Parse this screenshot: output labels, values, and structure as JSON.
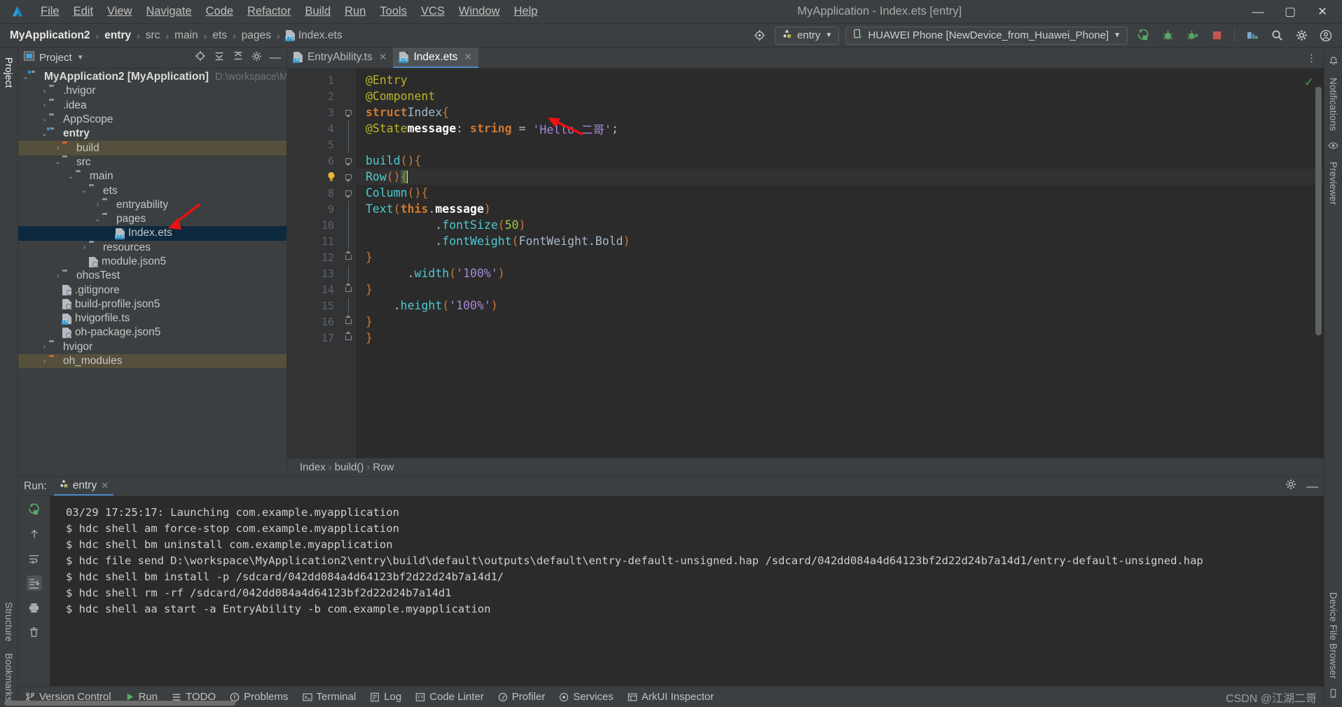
{
  "window": {
    "title": "MyApplication - Index.ets [entry]",
    "controls": {
      "minimize": "—",
      "maximize": "▢",
      "close": "✕"
    }
  },
  "menu": {
    "items": [
      "File",
      "Edit",
      "View",
      "Navigate",
      "Code",
      "Refactor",
      "Build",
      "Run",
      "Tools",
      "VCS",
      "Window",
      "Help"
    ]
  },
  "breadcrumbs": {
    "items": [
      "MyApplication2",
      "entry",
      "src",
      "main",
      "ets",
      "pages"
    ],
    "file": "Index.ets",
    "separator": "›"
  },
  "toolbar": {
    "target_icon": "device-target-icon",
    "run_config": "entry",
    "device": "HUAWEI Phone [NewDevice_from_Huawei_Phone]",
    "dropdown_caret": "▼",
    "buttons": [
      {
        "name": "run-button",
        "glyph": "▷"
      },
      {
        "name": "debug-button",
        "glyph": "🐞"
      },
      {
        "name": "attach-debugger-button",
        "glyph": "🐞"
      },
      {
        "name": "stop-button",
        "glyph": "■"
      },
      {
        "name": "device-manager-button",
        "glyph": "▤"
      },
      {
        "name": "search-everywhere-button",
        "glyph": "🔍"
      },
      {
        "name": "settings-button",
        "glyph": "⚙"
      },
      {
        "name": "account-button",
        "glyph": "◎"
      }
    ]
  },
  "left_rail": {
    "tabs": [
      "Project",
      "Structure",
      "Bookmarks"
    ]
  },
  "right_rail": {
    "tabs": [
      "Notifications",
      "Previewer",
      "Device File Browser"
    ]
  },
  "project_panel": {
    "title": "Project",
    "caret": "▼",
    "header_icons": [
      "locate-icon",
      "expand-all-icon",
      "collapse-all-icon",
      "settings-icon",
      "hide-icon"
    ],
    "tree": [
      {
        "depth": 0,
        "arrow": "v",
        "icon": "folder-module",
        "label": "MyApplication2 [MyApplication]",
        "bold": true,
        "path": "D:\\workspace\\MyApplic",
        "state": "normal"
      },
      {
        "depth": 1,
        "arrow": ">",
        "icon": "folder",
        "label": ".hvigor",
        "bold": false,
        "path": "",
        "state": "normal"
      },
      {
        "depth": 1,
        "arrow": ">",
        "icon": "folder",
        "label": ".idea",
        "bold": false,
        "path": "",
        "state": "normal"
      },
      {
        "depth": 1,
        "arrow": ">",
        "icon": "folder",
        "label": "AppScope",
        "bold": false,
        "path": "",
        "state": "normal"
      },
      {
        "depth": 1,
        "arrow": "v",
        "icon": "folder-module",
        "label": "entry",
        "bold": true,
        "path": "",
        "state": "normal"
      },
      {
        "depth": 2,
        "arrow": ">",
        "icon": "folder-orange",
        "label": "build",
        "bold": false,
        "path": "",
        "state": "modified"
      },
      {
        "depth": 2,
        "arrow": "v",
        "icon": "folder",
        "label": "src",
        "bold": false,
        "path": "",
        "state": "normal"
      },
      {
        "depth": 3,
        "arrow": "v",
        "icon": "folder",
        "label": "main",
        "bold": false,
        "path": "",
        "state": "normal"
      },
      {
        "depth": 4,
        "arrow": "v",
        "icon": "folder",
        "label": "ets",
        "bold": false,
        "path": "",
        "state": "normal"
      },
      {
        "depth": 5,
        "arrow": ">",
        "icon": "folder",
        "label": "entryability",
        "bold": false,
        "path": "",
        "state": "normal"
      },
      {
        "depth": 5,
        "arrow": "v",
        "icon": "folder",
        "label": "pages",
        "bold": false,
        "path": "",
        "state": "normal"
      },
      {
        "depth": 6,
        "arrow": "",
        "icon": "file-ets",
        "label": "Index.ets",
        "bold": false,
        "path": "",
        "state": "selected"
      },
      {
        "depth": 4,
        "arrow": ">",
        "icon": "folder",
        "label": "resources",
        "bold": false,
        "path": "",
        "state": "normal"
      },
      {
        "depth": 4,
        "arrow": "",
        "icon": "file-json",
        "label": "module.json5",
        "bold": false,
        "path": "",
        "state": "normal"
      },
      {
        "depth": 2,
        "arrow": ">",
        "icon": "folder",
        "label": "ohosTest",
        "bold": false,
        "path": "",
        "state": "normal"
      },
      {
        "depth": 2,
        "arrow": "",
        "icon": "file-git",
        "label": ".gitignore",
        "bold": false,
        "path": "",
        "state": "normal"
      },
      {
        "depth": 2,
        "arrow": "",
        "icon": "file-json",
        "label": "build-profile.json5",
        "bold": false,
        "path": "",
        "state": "normal"
      },
      {
        "depth": 2,
        "arrow": "",
        "icon": "file-ts",
        "label": "hvigorfile.ts",
        "bold": false,
        "path": "",
        "state": "normal"
      },
      {
        "depth": 2,
        "arrow": "",
        "icon": "file-json",
        "label": "oh-package.json5",
        "bold": false,
        "path": "",
        "state": "normal"
      },
      {
        "depth": 1,
        "arrow": ">",
        "icon": "folder",
        "label": "hvigor",
        "bold": false,
        "path": "",
        "state": "normal"
      },
      {
        "depth": 1,
        "arrow": ">",
        "icon": "folder-orange",
        "label": "oh_modules",
        "bold": false,
        "path": "",
        "state": "modified"
      }
    ]
  },
  "editor": {
    "tabs": [
      {
        "label": "EntryAbility.ts",
        "icon": "file-ts",
        "active": false,
        "close": "✕"
      },
      {
        "label": "Index.ets",
        "icon": "file-ets",
        "active": true,
        "close": "✕"
      }
    ],
    "kebab": "⋮",
    "inspection_ok": "✓",
    "line_numbers": [
      "1",
      "2",
      "3",
      "4",
      "5",
      "6",
      "7",
      "8",
      "9",
      "10",
      "11",
      "12",
      "13",
      "14",
      "15",
      "16",
      "17"
    ],
    "code": [
      "@Entry",
      "@Component",
      "struct Index {",
      "  @State message: string = 'Hello 二哥';",
      "",
      "  build() {",
      "    Row() {",
      "      Column() {",
      "        Text(this.message)",
      "          .fontSize(50)",
      "          .fontWeight(FontWeight.Bold)",
      "      }",
      "      .width('100%')",
      "    }",
      "    .height('100%')",
      "  }",
      "}"
    ],
    "breadcrumb": [
      "Index",
      "build()",
      "Row"
    ],
    "breadcrumb_sep": "›"
  },
  "run_panel": {
    "label": "Run:",
    "tab": "entry",
    "tab_close": "✕",
    "settings_icon": "⚙",
    "minimize_icon": "—",
    "rail_buttons": [
      "rerun-icon",
      "scroll-up-icon",
      "soft-wrap-icon",
      "scroll-to-end-icon",
      "print-icon",
      "clear-all-icon"
    ],
    "console": [
      "03/29 17:25:17: Launching com.example.myapplication",
      "$ hdc shell am force-stop com.example.myapplication",
      "$ hdc shell bm uninstall com.example.myapplication",
      "$ hdc file send D:\\workspace\\MyApplication2\\entry\\build\\default\\outputs\\default\\entry-default-unsigned.hap /sdcard/042dd084a4d64123bf2d22d24b7a14d1/entry-default-unsigned.hap",
      "$ hdc shell bm install -p /sdcard/042dd084a4d64123bf2d22d24b7a14d1/",
      "$ hdc shell rm -rf /sdcard/042dd084a4d64123bf2d22d24b7a14d1",
      "$ hdc shell aa start -a EntryAbility -b com.example.myapplication"
    ]
  },
  "status_bar": {
    "items": [
      {
        "name": "status-version-control",
        "icon": "branch-icon",
        "label": "Version Control"
      },
      {
        "name": "status-run",
        "icon": "play-icon",
        "label": "Run"
      },
      {
        "name": "status-todo",
        "icon": "list-icon",
        "label": "TODO"
      },
      {
        "name": "status-problems",
        "icon": "warning-icon",
        "label": "Problems"
      },
      {
        "name": "status-terminal",
        "icon": "terminal-icon",
        "label": "Terminal"
      },
      {
        "name": "status-log",
        "icon": "log-icon",
        "label": "Log"
      },
      {
        "name": "status-code-linter",
        "icon": "linter-icon",
        "label": "Code Linter"
      },
      {
        "name": "status-profiler",
        "icon": "profiler-icon",
        "label": "Profiler"
      },
      {
        "name": "status-services",
        "icon": "services-icon",
        "label": "Services"
      },
      {
        "name": "status-arkui-inspector",
        "icon": "inspector-icon",
        "label": "ArkUI Inspector"
      }
    ],
    "watermark": "CSDN @江湖二哥"
  },
  "colors": {
    "accent": "#4a88c7",
    "selection": "#0d293e",
    "modified": "#55503c",
    "editor_bg": "#2b2b2b",
    "panel_bg": "#3c3f41",
    "annotation_arrow": "#ee1111"
  }
}
